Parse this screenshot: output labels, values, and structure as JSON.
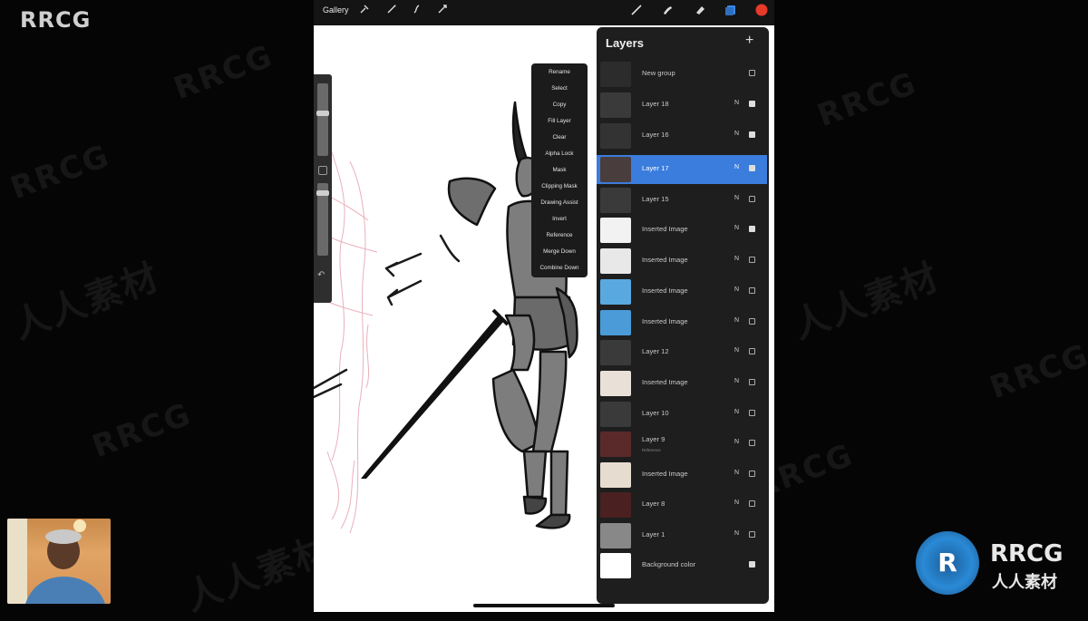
{
  "watermark": {
    "logo": "RRCG",
    "latin": "RRCG",
    "chinese": "人人素材"
  },
  "toolbar": {
    "gallery_label": "Gallery",
    "icons": [
      "wrench-icon",
      "magic-wand-icon",
      "selection-icon",
      "transform-icon",
      "brush-icon",
      "smudge-icon",
      "eraser-icon",
      "layers-icon",
      "color-icon"
    ],
    "color_swatch": "#e8392b",
    "layers_icon_color": "#3a87e8"
  },
  "layer_menu": {
    "items": [
      "Rename",
      "Select",
      "Copy",
      "Fill Layer",
      "Clear",
      "Alpha Lock",
      "Mask",
      "Clipping Mask",
      "Drawing Assist",
      "Invert",
      "Reference",
      "Merge Down",
      "Combine Down"
    ]
  },
  "layers_panel": {
    "title": "Layers",
    "add_icon": "plus-icon",
    "selected_color": "#3b7ddd",
    "layers": [
      {
        "name": "New group",
        "blend": "",
        "visible": false,
        "thumb": "#2c2c2c"
      },
      {
        "name": "Layer 18",
        "blend": "N",
        "visible": true,
        "thumb": "#3a3a3a"
      },
      {
        "name": "Layer 16",
        "blend": "N",
        "visible": true,
        "thumb": "#333333"
      },
      {
        "name": "Layer 17",
        "blend": "N",
        "visible": true,
        "thumb": "#4a3d3d",
        "selected": true
      },
      {
        "name": "Layer 15",
        "blend": "N",
        "visible": false,
        "thumb": "#3a3a3a"
      },
      {
        "name": "Inserted Image",
        "blend": "N",
        "visible": true,
        "thumb": "#f2f2f2"
      },
      {
        "name": "Inserted Image",
        "blend": "N",
        "visible": false,
        "thumb": "#e8e8e8"
      },
      {
        "name": "Inserted Image",
        "blend": "N",
        "visible": false,
        "thumb": "#5aa8e0"
      },
      {
        "name": "Inserted Image",
        "blend": "N",
        "visible": false,
        "thumb": "#4a9bd8"
      },
      {
        "name": "Layer 12",
        "blend": "N",
        "visible": false,
        "thumb": "#3a3a3a"
      },
      {
        "name": "Inserted Image",
        "blend": "N",
        "visible": false,
        "thumb": "#e9e0d8"
      },
      {
        "name": "Layer 10",
        "blend": "N",
        "visible": false,
        "thumb": "#3a3a3a"
      },
      {
        "name": "Layer 9",
        "sub": "Reference",
        "blend": "N",
        "visible": false,
        "thumb": "#5a2a2a"
      },
      {
        "name": "Inserted Image",
        "blend": "N",
        "visible": false,
        "thumb": "#e6dccf"
      },
      {
        "name": "Layer 8",
        "blend": "N",
        "visible": false,
        "thumb": "#4a2020"
      },
      {
        "name": "Layer 1",
        "blend": "N",
        "visible": false,
        "thumb": "#888888"
      },
      {
        "name": "Background color",
        "blend": "",
        "visible": true,
        "thumb": "#ffffff"
      }
    ]
  },
  "brand": {
    "name": "RRCG",
    "chinese": "人人素材",
    "emblem": "R"
  }
}
